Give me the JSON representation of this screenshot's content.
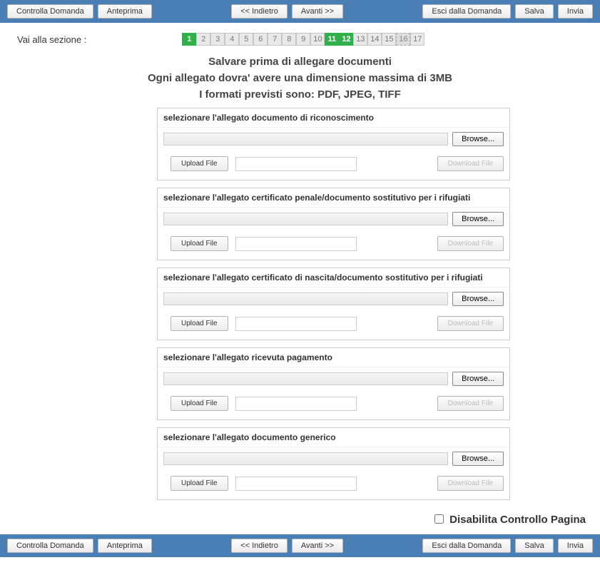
{
  "toolbar": {
    "check": "Controlla Domanda",
    "preview": "Anteprima",
    "back": "<< Indietro",
    "next": "Avanti >>",
    "exit": "Esci dalla Domanda",
    "save": "Salva",
    "send": "Invia"
  },
  "nav": {
    "label": "Vai alla sezione :",
    "pages": [
      "1",
      "2",
      "3",
      "4",
      "5",
      "6",
      "7",
      "8",
      "9",
      "10",
      "11",
      "12",
      "13",
      "14",
      "15",
      "16",
      "17"
    ],
    "active": [
      1,
      11,
      12
    ],
    "current": 16
  },
  "instructions": {
    "line1": "Salvare prima di allegare documenti",
    "line2": "Ogni allegato dovra' avere una dimensione massima di 3MB",
    "line3": "I formati previsti sono: PDF, JPEG, TIFF"
  },
  "common": {
    "browse": "Browse...",
    "upload": "Upload File",
    "download": "Download File"
  },
  "sections": [
    {
      "title": "selezionare l'allegato documento di riconoscimento"
    },
    {
      "title": "selezionare l'allegato certificato penale/documento sostitutivo per i rifugiati"
    },
    {
      "title": "selezionare l'allegato certificato di nascita/documento sostitutivo per i rifugiati"
    },
    {
      "title": "selezionare l'allegato ricevuta pagamento"
    },
    {
      "title": "selezionare l'allegato documento generico"
    }
  ],
  "footer": {
    "disable_label": "Disabilita Controllo Pagina"
  }
}
